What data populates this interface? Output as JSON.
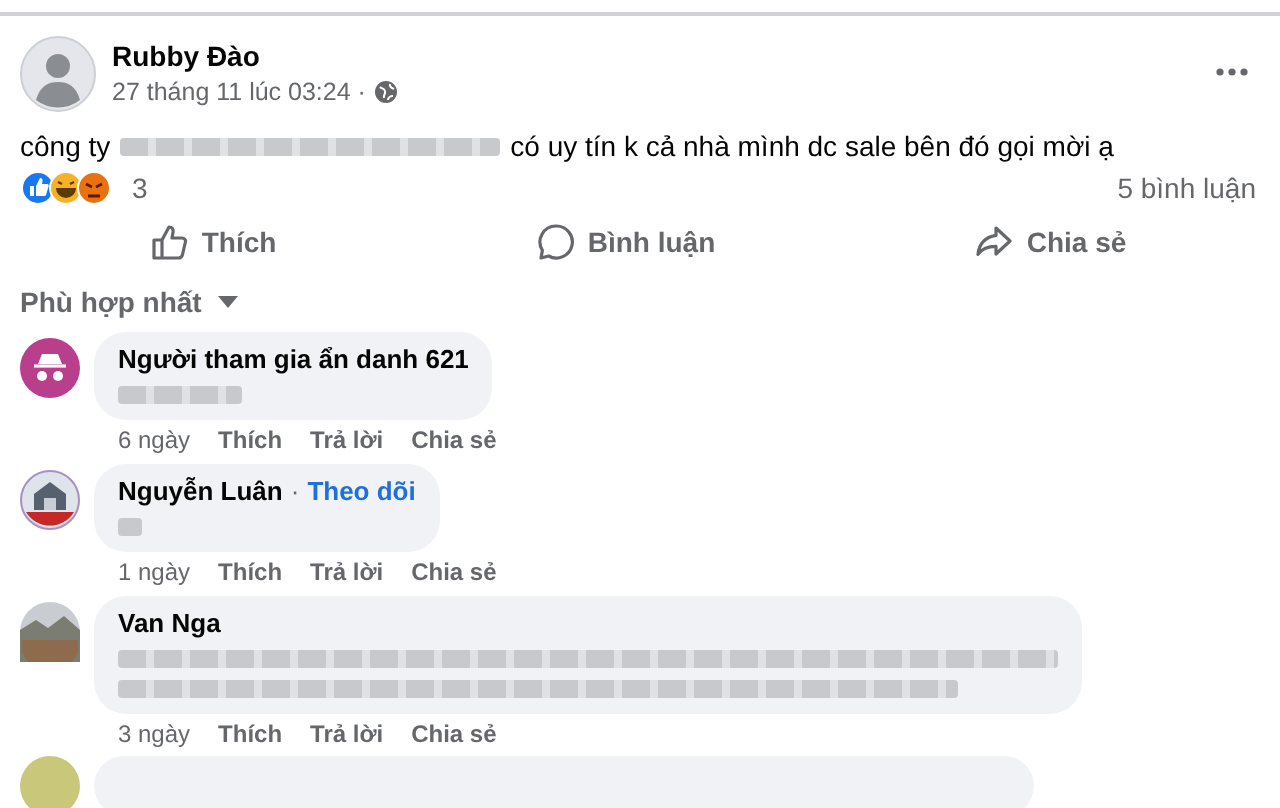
{
  "post": {
    "author": "Rubby Đào",
    "time": "27 tháng 11 lúc 03:24 ·",
    "text_before": "công ty",
    "text_after": "có uy tín k cả nhà mình dc sale bên đó gọi mời ạ",
    "reaction_count": "3",
    "comment_count": "5 bình luận"
  },
  "actions": [
    {
      "kind": "like",
      "label": "Thích"
    },
    {
      "kind": "comment",
      "label": "Bình luận"
    },
    {
      "kind": "share",
      "label": "Chia sẻ"
    }
  ],
  "sort": {
    "label": "Phù hợp nhất"
  },
  "comments": [
    {
      "avatar": {
        "kind": "anonymous"
      },
      "author": "Người tham gia ẩn danh 621",
      "body": {
        "kind": "short"
      },
      "time": "6 ngày",
      "actions": [
        "Thích",
        "Trả lời",
        "Chia sẻ"
      ]
    },
    {
      "avatar": {
        "kind": "logo"
      },
      "author": "Nguyễn Luân",
      "separator": "·",
      "follow": "Theo dõi",
      "body": {
        "kind": "tiny"
      },
      "time": "1 ngày",
      "actions": [
        "Thích",
        "Trả lời",
        "Chia sẻ"
      ]
    },
    {
      "avatar": {
        "kind": "photo"
      },
      "author": "Van Nga",
      "body": {
        "kind": "long"
      },
      "time": "3 ngày",
      "actions": [
        "Thích",
        "Trả lời",
        "Chia sẻ"
      ]
    }
  ]
}
